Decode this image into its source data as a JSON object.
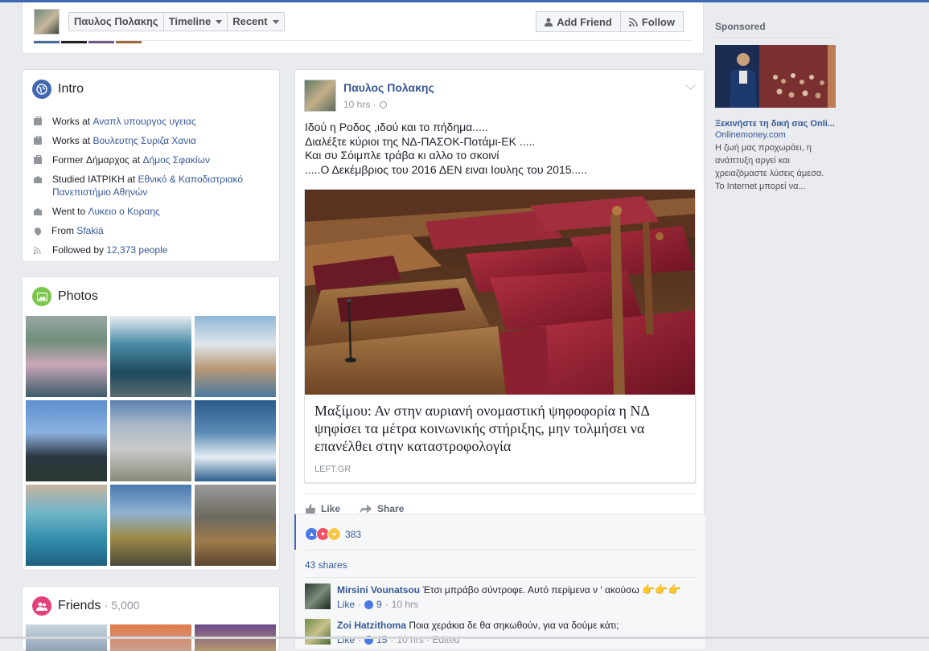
{
  "header": {
    "profile_name": "Παυλος Πολακης",
    "timeline_label": "Timeline",
    "recent_label": "Recent",
    "add_friend_label": "Add Friend",
    "follow_label": "Follow"
  },
  "intro": {
    "title": "Intro",
    "rows": [
      {
        "prefix": "Works at ",
        "link": "Αναπλ υπουργος υγειας"
      },
      {
        "prefix": "Works at ",
        "link": "Βουλευτης Συριζα Χανια"
      },
      {
        "prefix": "Former Δήμαρχος at ",
        "link": "Δήμος Σφακίων"
      },
      {
        "prefix": "Studied ΙΑΤΡΙΚΗ at ",
        "link": "Εθνικό & Καποδιστριακό Πανεπιστήμιο Αθηνών"
      },
      {
        "prefix": "Went to ",
        "link": "Λυκειο ο Κοραης"
      },
      {
        "prefix": "From ",
        "link": "Sfakiá"
      },
      {
        "prefix": "Followed by ",
        "link": "12,373 people"
      }
    ]
  },
  "photos": {
    "title": "Photos"
  },
  "friends": {
    "title": "Friends",
    "count": "· 5,000"
  },
  "post": {
    "author": "Παυλος Πολακης",
    "time": "10 hrs ·",
    "lines": [
      "Ιδού η Ροδος ,ιδού και το πήδημα.....",
      "Διαλέξτε κύριοι της ΝΔ-ΠΑΣΟΚ-Ποτάμι-ΕΚ .....",
      "Και συ Σόιμπλε τράβα κι αλλο το σκοινί",
      ".....Ο Δεκέμβριος του 2016 ΔΕΝ ειναι Ιουλης του 2015....."
    ],
    "link_title": "Μαξίμου: Αν στην αυριανή ονομαστική ψηφοφορία η ΝΔ ψηφίσει τα μέτρα κοινωνικής στήριξης, μην τολμήσει να επανέλθει στην καταστροφολογία",
    "link_domain": "LEFT.GR",
    "like_label": "Like",
    "share_label": "Share",
    "reactions_count": "383",
    "shares": "43 shares",
    "comments": [
      {
        "name": "Mirsini Vounatsou",
        "text": " Έτσι μπράβο σύντροφε. Αυτό περίμενα ν ' ακούσω ",
        "emoji": "👉👉👉",
        "like": "Like",
        "likes": "9",
        "time": "10 hrs"
      },
      {
        "name": "Zoi Hatzithoma",
        "text": " Ποια χεράκια δε θα σηκωθούν, για να δούμε κάτι;",
        "like": "Like",
        "likes": "15",
        "time": "10 hrs · Edited"
      }
    ]
  },
  "sponsored": {
    "heading": "Sponsored",
    "title": "Ξεκινήστε τη δική σας Onli...",
    "domain": "Onlinemoney.com",
    "text": "Η ζωή μας προχωράει, η ανάπτυξη αργεί και χρειαζόμαστε λύσεις άμεσα. Το Internet μπορεί να..."
  },
  "colors": {
    "brand": "#4267b2",
    "link": "#365899",
    "page_bg": "#e9ebee"
  }
}
